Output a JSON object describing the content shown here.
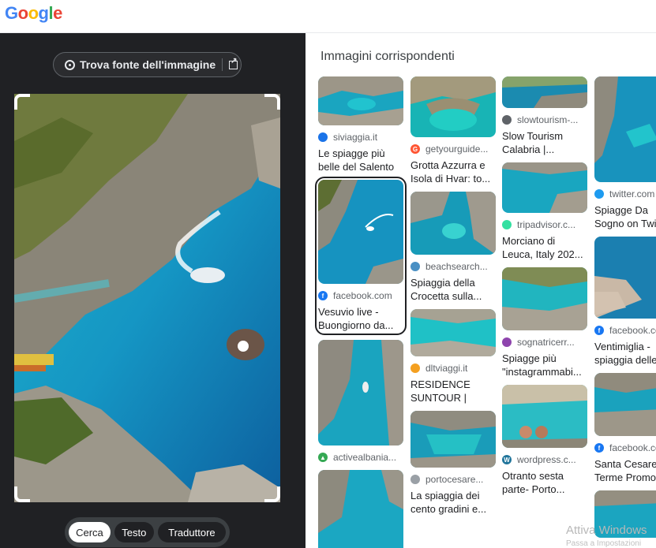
{
  "header": {
    "logo_letters": [
      "G",
      "o",
      "o",
      "g",
      "l",
      "e"
    ]
  },
  "left": {
    "find_source_label": "Trova fonte dell'immagine",
    "tabs": [
      {
        "label": "Cerca",
        "active": true
      },
      {
        "label": "Testo",
        "active": false
      },
      {
        "label": "Traduttore",
        "active": false
      }
    ]
  },
  "right": {
    "title": "Immagini corrispondenti",
    "columns": [
      [
        {
          "source": "siviaggia.it",
          "title": "Le spiagge più belle del Salento",
          "fav_color": "#1a73e8",
          "fav": "siviaggia-icon"
        },
        {
          "source": "facebook.com",
          "title": "Vesuvio live - Buongiorno da...",
          "fav_color": "#1877f2",
          "fav": "facebook-icon",
          "selected": true
        },
        {
          "source": "activealbania...",
          "title": "",
          "fav_color": "#34a853",
          "fav": "activealbania-icon"
        },
        {
          "source": "",
          "title": "",
          "fav": ""
        }
      ],
      [
        {
          "source": "getyourguide...",
          "title": "Grotta Azzurra e Isola di Hvar: to...",
          "fav_color": "#ff5533",
          "fav": "getyourguide-icon"
        },
        {
          "source": "beachsearch...",
          "title": "Spiaggia della Crocetta sulla...",
          "fav_color": "#4a90c4",
          "fav": "beachsearcher-icon"
        },
        {
          "source": "dltviaggi.it",
          "title": "RESIDENCE SUNTOUR | Sant...",
          "fav_color": "#f4a020",
          "fav": "dltviaggi-icon"
        },
        {
          "source": "portocesare...",
          "title": "La spiaggia dei cento gradini e...",
          "fav_color": "#9aa0a6",
          "fav": "portocesareo-icon"
        }
      ],
      [
        {
          "source": "slowtourism-...",
          "title": "Slow Tourism Calabria |...",
          "fav_color": "#5f6368",
          "fav": "globe-icon"
        },
        {
          "source": "tripadvisor.c...",
          "title": "Morciano di Leuca, Italy 202...",
          "fav_color": "#34e0a1",
          "fav": "tripadvisor-icon"
        },
        {
          "source": "sognatricerr...",
          "title": "Spiagge più \"instagrammabi...",
          "fav_color": "#8e44ad",
          "fav": "sognatrice-icon"
        },
        {
          "source": "wordpress.c...",
          "title": "Otranto sesta parte- Porto...",
          "fav_color": "#21759b",
          "fav": "wordpress-icon"
        }
      ],
      [
        {
          "source": "twitter.com",
          "title": "Spiagge Da Sogno on Twi...",
          "fav_color": "#1d9bf0",
          "fav": "twitter-icon"
        },
        {
          "source": "facebook.com",
          "title": "Ventimiglia - spiaggia delle...",
          "fav_color": "#1877f2",
          "fav": "facebook-icon"
        },
        {
          "source": "facebook.com",
          "title": "Santa Cesarea Terme Promo...",
          "fav_color": "#1877f2",
          "fav": "facebook-icon"
        },
        {
          "source": "",
          "title": "",
          "fav": ""
        }
      ]
    ]
  },
  "watermark": {
    "line1": "Attiva Windows",
    "line2": "Passa a Impostazioni"
  }
}
